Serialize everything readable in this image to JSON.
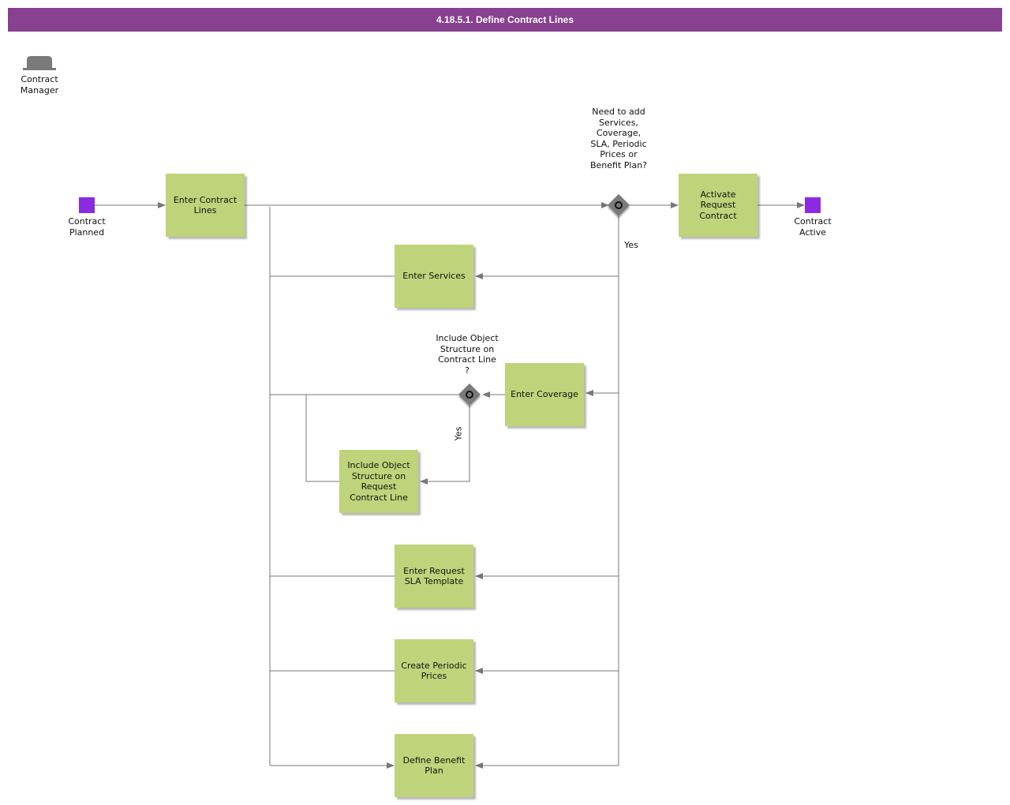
{
  "title": "4.18.5.1. Define Contract Lines",
  "role": {
    "label": "Contract Manager",
    "icon": "hat-icon"
  },
  "events": {
    "start": "Contract Planned",
    "end": "Contract Active"
  },
  "tasks": {
    "enter_contract_lines": "Enter Contract Lines",
    "enter_services": "Enter Services",
    "enter_coverage": "Enter Coverage",
    "include_object_structure": "Include Object Structure on Request Contract Line",
    "enter_sla_template": "Enter Request SLA Template",
    "create_periodic_prices": "Create Periodic Prices",
    "define_benefit_plan": "Define Benefit Plan",
    "activate_request_contract": "Activate Request Contract"
  },
  "gateways": {
    "need_to_add": "Need to add Services, Coverage, SLA, Periodic Prices or Benefit Plan?",
    "include_object_structure": "Include Object Structure on Contract Line ?"
  },
  "flow_labels": {
    "yes_1": "Yes",
    "yes_2": "Yes"
  },
  "colors": {
    "header": "#87418f",
    "task": "#bfd47a",
    "event": "#8a2be2",
    "gateway": "#7a7a7a",
    "flow": "#777777"
  }
}
